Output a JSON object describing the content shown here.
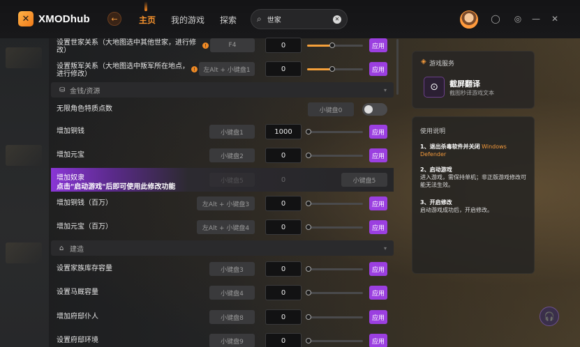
{
  "header": {
    "logo_text": "XMODhub",
    "nav": [
      {
        "label": "主页",
        "active": true
      },
      {
        "label": "我的游戏",
        "active": false
      },
      {
        "label": "探索",
        "active": false
      }
    ],
    "search": {
      "value": "世家",
      "placeholder": ""
    },
    "icons": [
      "back-arrow-icon",
      "search-icon",
      "clear-icon",
      "avatar",
      "notification-icon",
      "settings-icon",
      "minimize-icon",
      "close-icon"
    ]
  },
  "rows": [
    {
      "label": "设置世家关系（大地图选中其他世家，进行修改）",
      "key": "F4",
      "value": "0",
      "slider": 0.45,
      "apply": "应用",
      "warn": true
    },
    {
      "label": "设置叛军关系（大地图选中叛军所在地点，进行修改）",
      "key": "左Alt + 小键盘1",
      "value": "0",
      "slider": 0.45,
      "apply": "应用",
      "warn": true
    }
  ],
  "sections": {
    "money": {
      "title": "金钱/资源",
      "icon": "coins-icon"
    },
    "build": {
      "title": "建造",
      "icon": "building-icon"
    }
  },
  "money_rows": [
    {
      "label": "无限角色特质点数",
      "key": "小键盘0",
      "toggle": false
    },
    {
      "label": "增加铜钱",
      "key": "小键盘1",
      "value": "1000",
      "slider": 0.0,
      "apply": "应用"
    },
    {
      "label": "增加元宝",
      "key": "小键盘2",
      "value": "0",
      "slider": 0.0,
      "apply": "应用"
    },
    {
      "label": "增加铜钱（百万）",
      "key": "左Alt + 小键盘3",
      "value": "0",
      "slider": 0.0,
      "apply": "应用"
    },
    {
      "label": "增加元宝（百万）",
      "key": "左Alt + 小键盘4",
      "value": "0",
      "slider": 0.0,
      "apply": "应用"
    }
  ],
  "promo": {
    "title": "增加奴隶",
    "subtitle": "点击\"启动游戏\"后即可使用此修改功能",
    "key_faded": "小键盘5",
    "value_faded": "0",
    "key": "小键盘5"
  },
  "build_rows": [
    {
      "label": "设置家族库存容量",
      "key": "小键盘3",
      "value": "0",
      "slider": 0.0,
      "apply": "应用"
    },
    {
      "label": "设置马厩容量",
      "key": "小键盘4",
      "value": "0",
      "slider": 0.0,
      "apply": "应用"
    },
    {
      "label": "增加府邸仆人",
      "key": "小键盘8",
      "value": "0",
      "slider": 0.0,
      "apply": "应用"
    },
    {
      "label": "设置府邸环境",
      "key": "小键盘9",
      "value": "0",
      "slider": 0.0,
      "apply": "应用"
    }
  ],
  "service": {
    "title": "游戏服务",
    "app_title": "截屏翻译",
    "app_sub": "截图秒译游戏文本"
  },
  "help": {
    "title": "使用说明",
    "step1_title": "1、退出杀毒软件并关闭",
    "step1_hl": "Windows Defender",
    "step2_title": "2、启动游戏",
    "step2_text": "进入游戏，需保持单机；非正版游戏修改可能无法生效。",
    "step3_title": "3、开启修改",
    "step3_text": "启动游戏成功后，开启修改。"
  },
  "colors": {
    "accent": "#f6922d",
    "apply": "#9b3fe0",
    "slider_fill": "#f5a03a"
  }
}
